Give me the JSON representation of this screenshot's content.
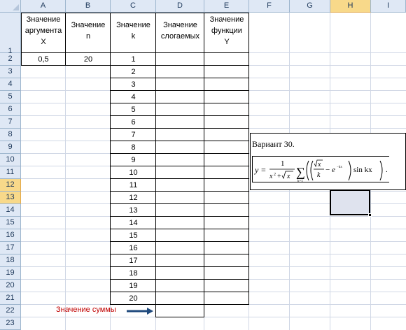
{
  "columns": [
    "A",
    "B",
    "C",
    "D",
    "E",
    "F",
    "G",
    "H",
    "I"
  ],
  "rows": [
    "1",
    "2",
    "3",
    "4",
    "5",
    "6",
    "7",
    "8",
    "9",
    "10",
    "11",
    "12",
    "13",
    "14",
    "15",
    "16",
    "17",
    "18",
    "19",
    "20",
    "21",
    "22",
    "23"
  ],
  "headers": {
    "a": [
      "Значение",
      "аргумента",
      "X"
    ],
    "b": [
      "Значение",
      "n"
    ],
    "c": [
      "Значение",
      "k"
    ],
    "d": [
      "Значение",
      "слогаемых"
    ],
    "e": [
      "Значение",
      "функции",
      "Y"
    ]
  },
  "values": {
    "x": "0,5",
    "n": "20"
  },
  "k_values": [
    "1",
    "2",
    "3",
    "4",
    "5",
    "6",
    "7",
    "8",
    "9",
    "10",
    "11",
    "12",
    "13",
    "14",
    "15",
    "16",
    "17",
    "18",
    "19",
    "20"
  ],
  "sum_label": "Значение суммы",
  "formula": {
    "title": "Вариант 30.",
    "y": "y",
    "eq": "=",
    "one": "1",
    "sigma": "∑",
    "sum_top": "",
    "sum_bottom": "k=1",
    "x_pow": "x",
    "two": "2",
    "plus": "+",
    "x": "x",
    "k": "k",
    "minus": "−",
    "e": "e",
    "exp": "−kx",
    "sin_kx": "sin kx",
    "dot": "."
  },
  "selection": {
    "column": "H",
    "rows": [
      "13",
      "14"
    ]
  },
  "colors": {
    "header_bg": "#dfe8f5",
    "selected_header": "#f8d98a",
    "grid": "#d0d7e5",
    "sum_text": "#c00000",
    "arrow": "#1f497d"
  }
}
